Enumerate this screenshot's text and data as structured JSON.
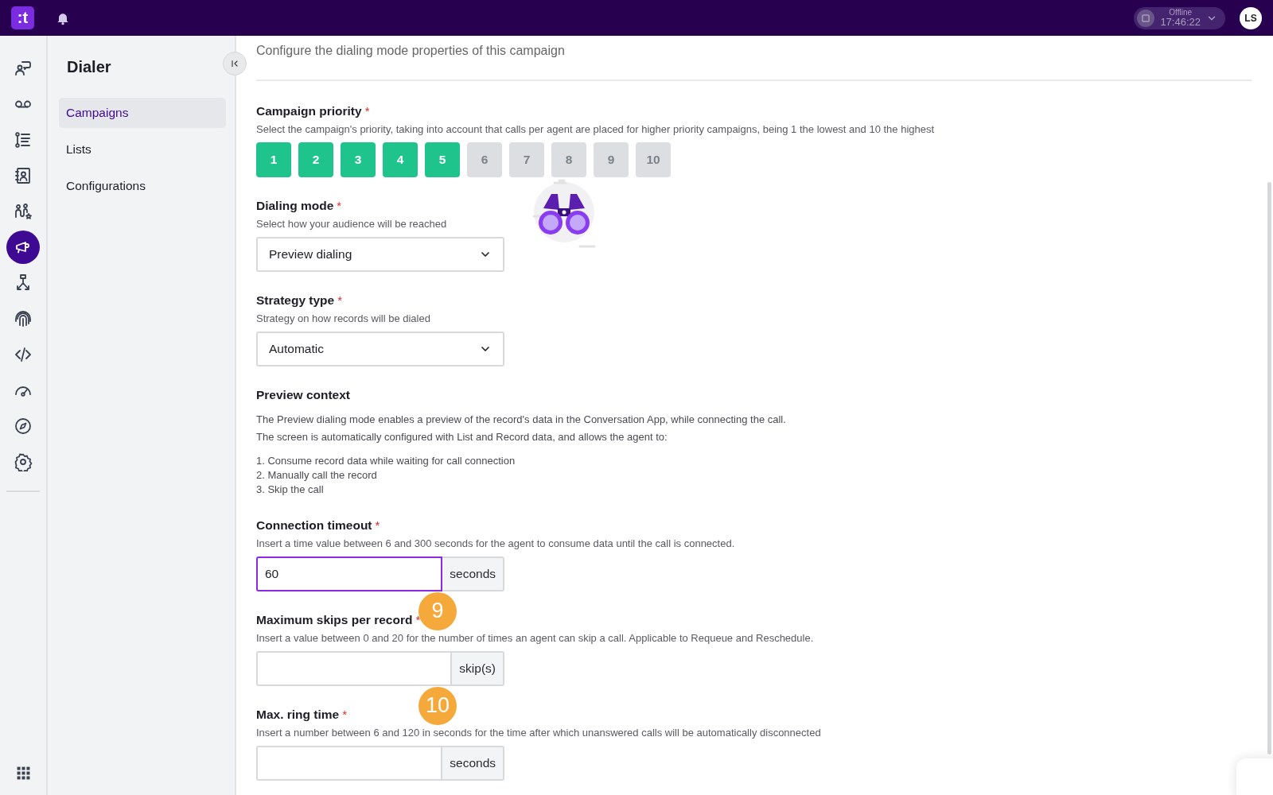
{
  "topbar": {
    "logo": ":t",
    "status": {
      "label": "Offline",
      "time": "17:46:22"
    },
    "avatar": "LS"
  },
  "rail": [
    {
      "kind": "chat",
      "selected": false
    },
    {
      "kind": "voicemail",
      "selected": false
    },
    {
      "kind": "list",
      "selected": false
    },
    {
      "kind": "contacts",
      "selected": false
    },
    {
      "kind": "people",
      "selected": false
    },
    {
      "kind": "megaphone",
      "selected": true
    },
    {
      "kind": "flow",
      "selected": false
    },
    {
      "kind": "fingerprint",
      "selected": false
    },
    {
      "kind": "code",
      "selected": false
    },
    {
      "kind": "gauge",
      "selected": false
    },
    {
      "kind": "compass",
      "selected": false
    },
    {
      "kind": "gear",
      "selected": false
    }
  ],
  "sidebar": {
    "title": "Dialer",
    "items": [
      {
        "label": "Campaigns",
        "selected": true
      },
      {
        "label": "Lists",
        "selected": false
      },
      {
        "label": "Configurations",
        "selected": false
      }
    ]
  },
  "header": {
    "subtitle": "Configure the dialing mode properties of this campaign"
  },
  "fields": [
    {
      "kind": "priority",
      "label": "Campaign priority",
      "required_mark": "*",
      "description": "Select the campaign's priority, taking into account that calls per agent are placed for higher priority campaigns, being 1 the lowest and 10 the highest",
      "options": [
        {
          "label": "1",
          "filled": true
        },
        {
          "label": "2",
          "filled": true
        },
        {
          "label": "3",
          "filled": true
        },
        {
          "label": "4",
          "filled": true
        },
        {
          "label": "5",
          "filled": true
        },
        {
          "label": "6",
          "filled": false
        },
        {
          "label": "7",
          "filled": false
        },
        {
          "label": "8",
          "filled": false
        },
        {
          "label": "9",
          "filled": false
        },
        {
          "label": "10",
          "filled": false
        }
      ]
    },
    {
      "kind": "select_illustrated",
      "label": "Dialing mode",
      "required_mark": "*",
      "description": "Select how your audience will be reached",
      "value": "Preview dialing"
    },
    {
      "kind": "select",
      "label": "Strategy type",
      "required_mark": "*",
      "description": "Strategy on how records will be dialed",
      "value": "Automatic"
    },
    {
      "kind": "info",
      "label": "Preview context",
      "paragraphs": [
        "The Preview dialing mode enables a preview of the record's data in the Conversation App, while connecting the call.",
        "The screen is automatically configured with List and Record data, and allows the agent to:"
      ],
      "list": [
        "1. Consume record data while waiting for call connection",
        "2. Manually call the record",
        "3. Skip the call"
      ]
    },
    {
      "kind": "input",
      "label": "Connection timeout",
      "required_mark": "*",
      "description": "Insert a time value between 6 and 300 seconds for the agent to consume data until the call is connected.",
      "value": "60",
      "unit": "seconds",
      "focused": true
    },
    {
      "kind": "input",
      "label": "Maximum skips per record",
      "required_mark": "*",
      "description": "Insert a value between 0 and 20 for the number of times an agent can skip a call. Applicable to Requeue and Reschedule.",
      "unit": "skip(s)",
      "focused": false,
      "badge": "9"
    },
    {
      "kind": "input",
      "label": "Max. ring time",
      "required_mark": "*",
      "description": "Insert a number between 6 and 120 in seconds for the time after which unanswered calls will be automatically disconnected",
      "unit": "seconds",
      "focused": false,
      "badge": "10"
    }
  ]
}
